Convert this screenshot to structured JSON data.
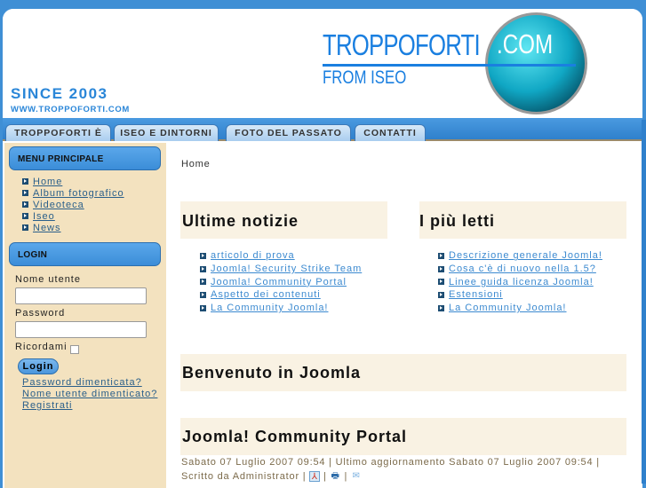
{
  "header": {
    "since": "SINCE 2003",
    "url": "WWW.TROPPOFORTI.COM",
    "logo_text": "TROPPOFORTI",
    "logo_com": ".COM",
    "logo_sub": "FROM ISEO"
  },
  "nav": [
    "TROPPOFORTI È",
    "ISEO E DINTORNI",
    "FOTO DEL PASSATO",
    "CONTATTI"
  ],
  "sidebar": {
    "menu_title": "MENU PRINCIPALE",
    "menu": [
      "Home",
      "Album fotografico",
      "Videoteca",
      "Iseo",
      "News"
    ],
    "login_title": "LOGIN",
    "username_label": "Nome utente",
    "password_label": "Password",
    "remember_label": "Ricordami",
    "login_button": "Login",
    "links": [
      "Password dimenticata?",
      "Nome utente dimenticato?",
      "Registrati"
    ]
  },
  "main": {
    "breadcrumb": "Home",
    "latest": {
      "title": "Ultime notizie",
      "items": [
        "articolo di prova",
        "Joomla! Security Strike Team",
        "Joomla! Community Portal",
        "Aspetto dei contenuti",
        "La Community Joomla!"
      ]
    },
    "popular": {
      "title": "I più letti",
      "items": [
        "Descrizione generale Joomla!",
        "Cosa c'è di nuovo nella 1.5?",
        "Linee guida licenza Joomla!",
        "Estensioni",
        "La Community Joomla!"
      ]
    },
    "welcome_title": "Benvenuto in Joomla",
    "article": {
      "title": "Joomla! Community Portal",
      "meta": "Sabato 07 Luglio 2007 09:54 | Ultimo aggiornamento Sabato 07 Luglio 2007 09:54 | Scritto da Administrator |"
    }
  }
}
